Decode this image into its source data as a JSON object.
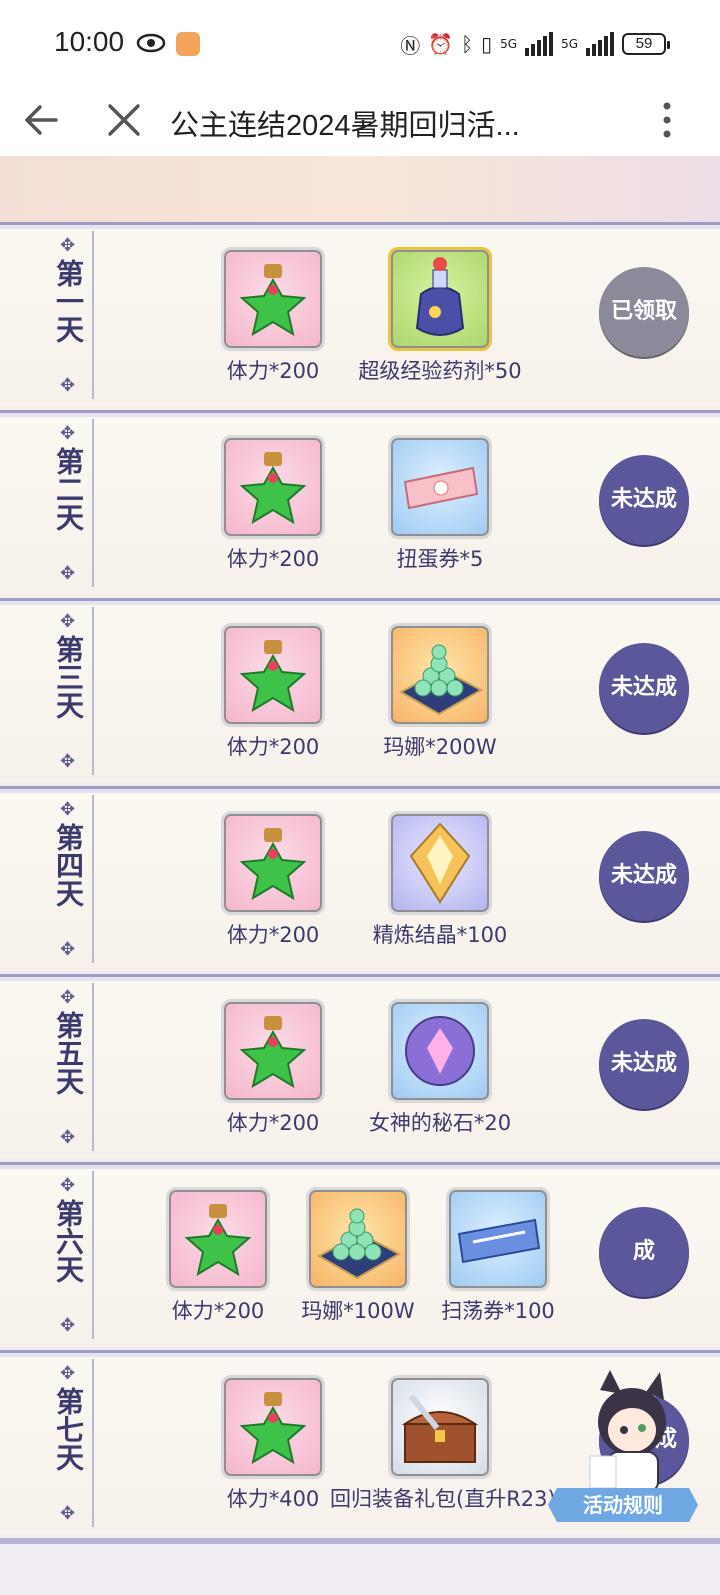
{
  "status_bar": {
    "time": "10:00",
    "battery": "59",
    "signal1_label": "5G",
    "signal2_label": "5G"
  },
  "nav": {
    "title": "公主连结2024暑期回归活..."
  },
  "rows": [
    {
      "day": "第一天",
      "items": [
        {
          "label": "体力*200",
          "icon": "stamina-potion-icon"
        },
        {
          "label": "超级经验药剂*50",
          "icon": "super-exp-potion-icon"
        }
      ],
      "status": "已领取"
    },
    {
      "day": "第二天",
      "items": [
        {
          "label": "体力*200",
          "icon": "stamina-potion-icon"
        },
        {
          "label": "扭蛋券*5",
          "icon": "gacha-ticket-icon"
        }
      ],
      "status": "未达成"
    },
    {
      "day": "第三天",
      "items": [
        {
          "label": "体力*200",
          "icon": "stamina-potion-icon"
        },
        {
          "label": "玛娜*200W",
          "icon": "mana-icon"
        }
      ],
      "status": "未达成"
    },
    {
      "day": "第四天",
      "items": [
        {
          "label": "体力*200",
          "icon": "stamina-potion-icon"
        },
        {
          "label": "精炼结晶*100",
          "icon": "refine-crystal-icon"
        }
      ],
      "status": "未达成"
    },
    {
      "day": "第五天",
      "items": [
        {
          "label": "体力*200",
          "icon": "stamina-potion-icon"
        },
        {
          "label": "女神的秘石*20",
          "icon": "goddess-stone-icon"
        }
      ],
      "status": "未达成"
    },
    {
      "day": "第六天",
      "items": [
        {
          "label": "体力*200",
          "icon": "stamina-potion-icon"
        },
        {
          "label": "玛娜*100W",
          "icon": "mana-icon"
        },
        {
          "label": "扫荡券*100",
          "icon": "sweep-ticket-icon"
        }
      ],
      "status": "成"
    },
    {
      "day": "第七天",
      "items": [
        {
          "label": "体力*400",
          "icon": "stamina-potion-icon"
        },
        {
          "label": "回归装备礼包(直升R23)",
          "icon": "equipment-chest-icon"
        }
      ],
      "status": "未达成"
    }
  ],
  "rules_button": {
    "label": "活动规则"
  },
  "colors": {
    "status_active": "#5a589a",
    "status_claimed": "#8a8a9a",
    "day_text": "#3b3a6c"
  }
}
